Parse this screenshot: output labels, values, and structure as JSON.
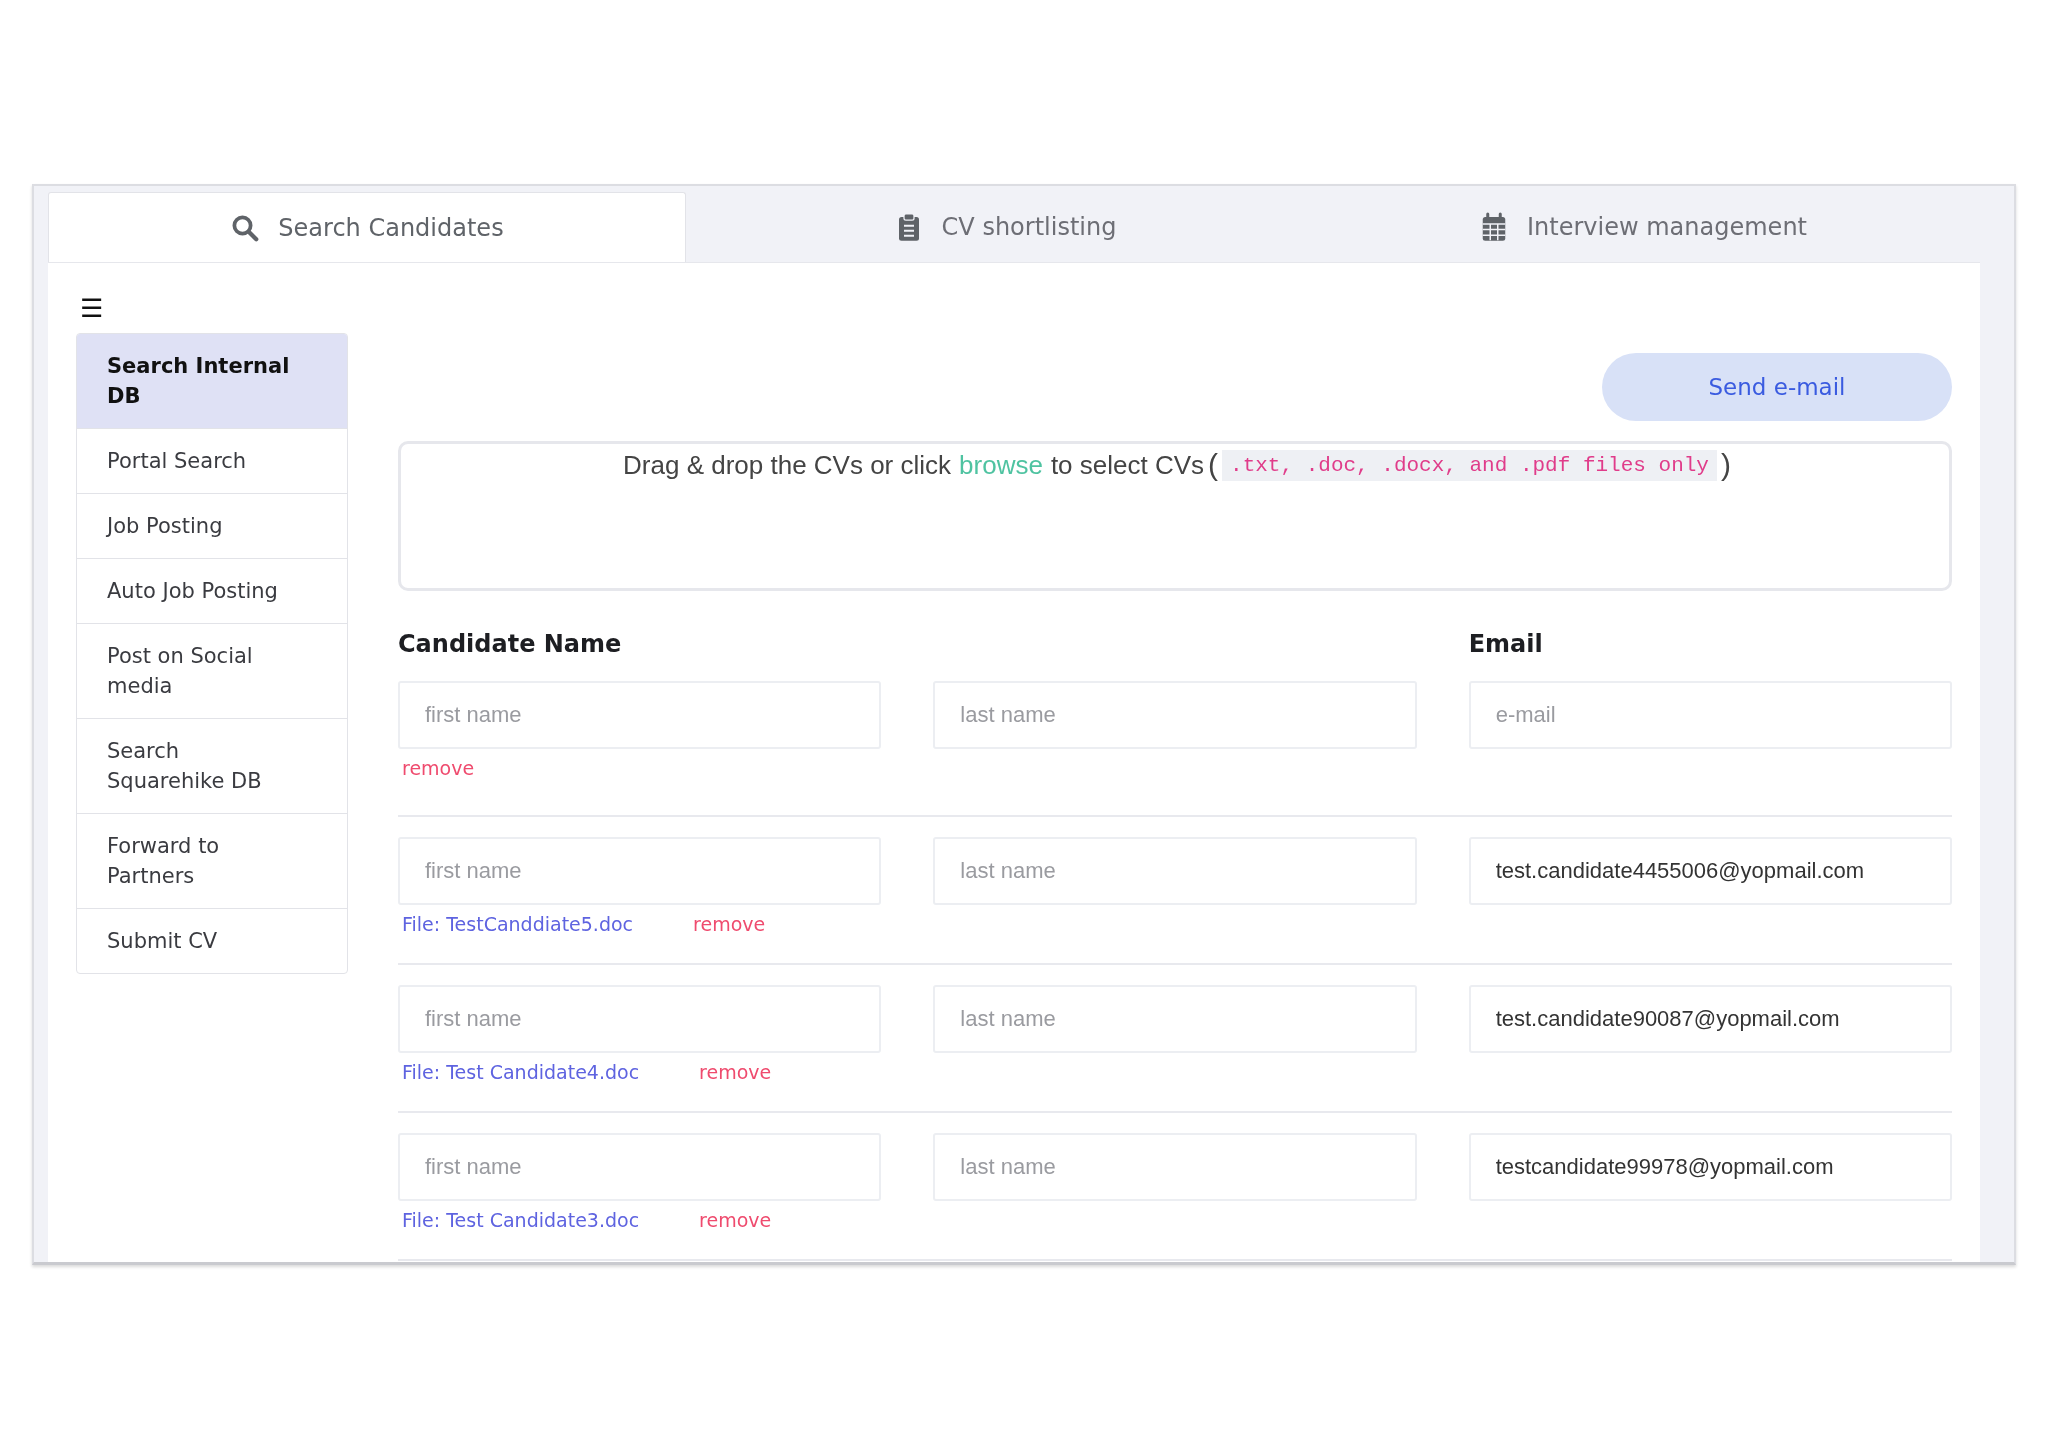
{
  "tabs": [
    {
      "label": "Search Candidates",
      "selected": true
    },
    {
      "label": "CV shortlisting",
      "selected": false
    },
    {
      "label": "Interview management",
      "selected": false
    }
  ],
  "sidebar": {
    "menu_icon": "☰",
    "items": [
      {
        "label": "Search Internal DB",
        "selected": true
      },
      {
        "label": "Portal Search",
        "selected": false
      },
      {
        "label": "Job Posting",
        "selected": false
      },
      {
        "label": "Auto Job Posting",
        "selected": false
      },
      {
        "label": "Post on Social media",
        "selected": false
      },
      {
        "label": "Search Squarehike DB",
        "selected": false
      },
      {
        "label": "Forward to Partners",
        "selected": false
      },
      {
        "label": "Submit CV",
        "selected": false
      }
    ]
  },
  "send_button": "Send e-mail",
  "dropzone": {
    "before": "Drag & drop the CVs or click",
    "link": "browse",
    "after": "to select CVs",
    "open": "(",
    "formats": ".txt, .doc, .docx, and .pdf files only",
    "close": ")"
  },
  "headings": {
    "name": "Candidate Name",
    "email": "Email"
  },
  "rows": [
    {
      "first_name": {
        "placeholder": "first name"
      },
      "last_name": {
        "placeholder": "last name"
      },
      "email": {
        "placeholder": "e-mail"
      },
      "remove": "remove"
    },
    {
      "first_name": {
        "placeholder": "first name"
      },
      "last_name": {
        "placeholder": "last name"
      },
      "email": {
        "value": "test.candidate4455006@yopmail.com"
      },
      "file": "File: TestCanddiate5.doc",
      "remove": "remove"
    },
    {
      "first_name": {
        "placeholder": "first name"
      },
      "last_name": {
        "placeholder": "last name"
      },
      "email": {
        "value": "test.candidate90087@yopmail.com"
      },
      "file": "File: Test Candidate4.doc",
      "remove": "remove"
    },
    {
      "first_name": {
        "placeholder": "first name"
      },
      "last_name": {
        "placeholder": "last name"
      },
      "email": {
        "value": "testcandidate99978@yopmail.com"
      },
      "file": "File: Test Candidate3.doc",
      "remove": "remove"
    }
  ]
}
